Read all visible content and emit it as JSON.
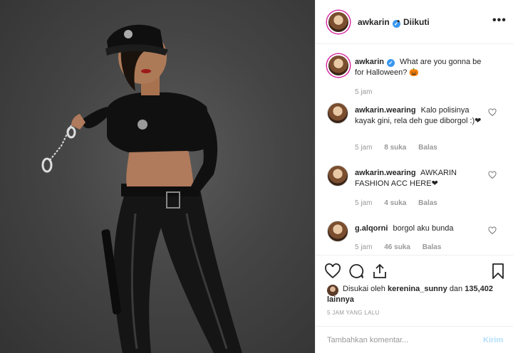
{
  "post": {
    "owner": "awkarin",
    "separator": "•",
    "follow_status": "Diikuti",
    "more": "•••"
  },
  "comments": [
    {
      "username": "awkarin",
      "text": "What are you gonna be for Halloween? 🎃",
      "time": "5 jam",
      "likes": "",
      "reply": "",
      "verified": true
    },
    {
      "username": "awkarin.wearing",
      "text": "Kalo polisinya kayak gini, rela deh gue diborgol :)❤",
      "time": "5 jam",
      "likes": "8 suka",
      "reply": "Balas"
    },
    {
      "username": "awkarin.wearing",
      "text": "AWKARIN FASHION ACC HERE❤",
      "time": "5 jam",
      "likes": "4 suka",
      "reply": "Balas"
    },
    {
      "username": "g.alqorni",
      "text": "borgol aku bunda",
      "time": "5 jam",
      "likes": "46 suka",
      "reply": "Balas"
    }
  ],
  "likes": {
    "prefix": "Disukai oleh",
    "user": "kerenina_sunny",
    "connector": "dan",
    "others": "135,402 lainnya"
  },
  "timestamp": "5 JAM YANG LALU",
  "comment_box": {
    "placeholder": "Tambahkan komentar...",
    "post_label": "Kirim"
  }
}
